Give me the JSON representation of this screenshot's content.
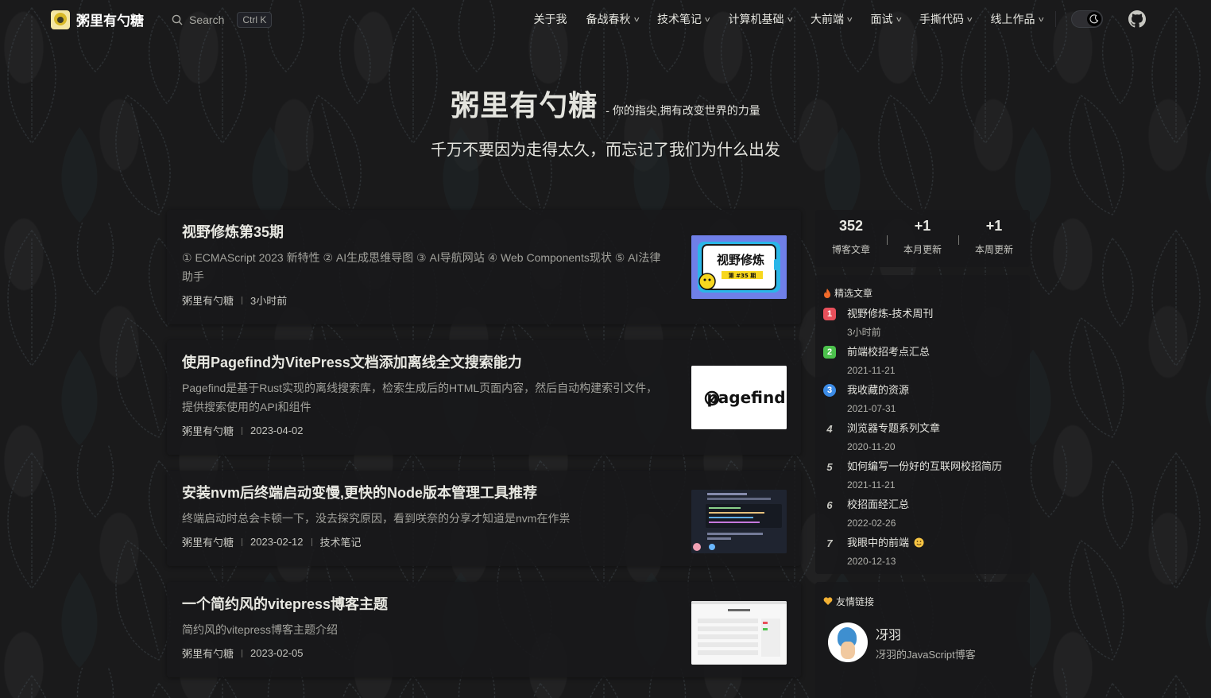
{
  "nav": {
    "brand": "粥里有勺糖",
    "search_label": "Search",
    "search_kbd": "Ctrl K",
    "menu": [
      {
        "label": "关于我",
        "dropdown": false
      },
      {
        "label": "备战春秋",
        "dropdown": true
      },
      {
        "label": "技术笔记",
        "dropdown": true
      },
      {
        "label": "计算机基础",
        "dropdown": true
      },
      {
        "label": "大前端",
        "dropdown": true
      },
      {
        "label": "面试",
        "dropdown": true
      },
      {
        "label": "手撕代码",
        "dropdown": true
      },
      {
        "label": "线上作品",
        "dropdown": true
      }
    ]
  },
  "hero": {
    "title": "粥里有勺糖",
    "tagline": "- 你的指尖,拥有改变世界的力量",
    "subtitle": "千万不要因为走得太久，而忘记了我们为什么出发"
  },
  "articles": [
    {
      "title": "视野修炼第35期",
      "desc": "① ECMAScript 2023 新特性 ② AI生成思维导图 ③ AI导航网站 ④ Web Components现状 ⑤ AI法律助手",
      "author": "粥里有勺糖",
      "date": "3小时前",
      "tag": "",
      "thumb_text": "视野修炼",
      "thumb_sub": "第 #35 期"
    },
    {
      "title": "使用Pagefind为VitePress文档添加离线全文搜索能力",
      "desc": "Pagefind是基于Rust实现的离线搜索库，检索生成后的HTML页面内容，然后自动构建索引文件，提供搜索使用的API和组件",
      "author": "粥里有勺糖",
      "date": "2023-04-02",
      "tag": "",
      "thumb_text": "pagefind"
    },
    {
      "title": "安装nvm后终端启动变慢,更快的Node版本管理工具推荐",
      "desc": "终端启动时总会卡顿一下，没去探究原因，看到咲奈的分享才知道是nvm在作祟",
      "author": "粥里有勺糖",
      "date": "2023-02-12",
      "tag": "技术笔记"
    },
    {
      "title": "一个简约风的vitepress博客主题",
      "desc": "简约风的vitepress博客主题介绍",
      "author": "粥里有勺糖",
      "date": "2023-02-05",
      "tag": ""
    }
  ],
  "stats": [
    {
      "num": "352",
      "label": "博客文章"
    },
    {
      "num": "+1",
      "label": "本月更新"
    },
    {
      "num": "+1",
      "label": "本周更新"
    }
  ],
  "featured": {
    "title": "精选文章",
    "items": [
      {
        "rank": "1",
        "title": "视野修炼-技术周刊",
        "date": "3小时前",
        "color": "#e8505b"
      },
      {
        "rank": "2",
        "title": "前端校招考点汇总",
        "date": "2021-11-21",
        "color": "#4cc14c"
      },
      {
        "rank": "3",
        "title": "我收藏的资源",
        "date": "2021-07-31",
        "color": "#3c8ce7"
      },
      {
        "rank": "4",
        "title": "浏览器专题系列文章",
        "date": "2020-11-20",
        "color": ""
      },
      {
        "rank": "5",
        "title": "如何编写一份好的互联网校招简历",
        "date": "2021-11-21",
        "color": ""
      },
      {
        "rank": "6",
        "title": "校招面经汇总",
        "date": "2022-02-26",
        "color": ""
      },
      {
        "rank": "7",
        "title": "我眼中的前端",
        "date": "2020-12-13",
        "color": ""
      }
    ]
  },
  "friends": {
    "title": "友情链接",
    "items": [
      {
        "name": "冴羽",
        "desc": "冴羽的JavaScript博客"
      }
    ]
  }
}
